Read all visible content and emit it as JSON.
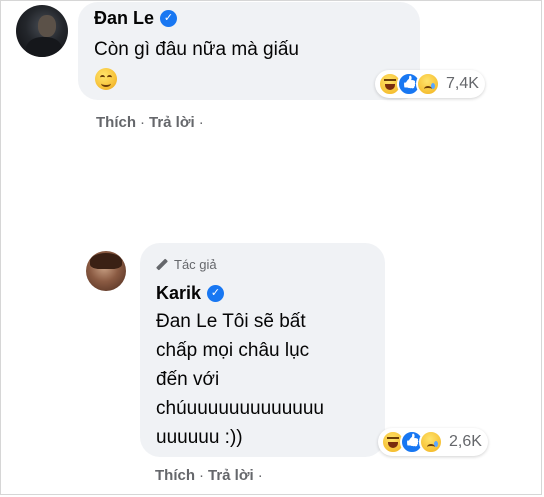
{
  "comments": [
    {
      "author": "Đan Le",
      "verified": true,
      "text": "Còn gì đâu nữa mà giấu",
      "emoji": "grinning-face-emoji",
      "reaction_count": "7,4K",
      "actions": {
        "like": "Thích",
        "separator": "·",
        "reply": "Trả lời",
        "trail": "·"
      }
    },
    {
      "badge": "Tác giả",
      "author": "Karik",
      "verified": true,
      "text": "Đan Le Tôi sẽ bất\nchấp mọi châu lục\nđến với\nchúuuuuuuuuuuuuu\nuuuuuu :))",
      "reaction_count": "2,6K",
      "actions": {
        "like": "Thích",
        "separator": "·",
        "reply": "Trả lời",
        "trail": "·"
      }
    }
  ],
  "reaction_icons": [
    "haha-icon",
    "like-icon",
    "sad-icon"
  ],
  "colors": {
    "bubble": "#f0f2f5",
    "verified": "#1877f2",
    "meta": "#65676b"
  }
}
